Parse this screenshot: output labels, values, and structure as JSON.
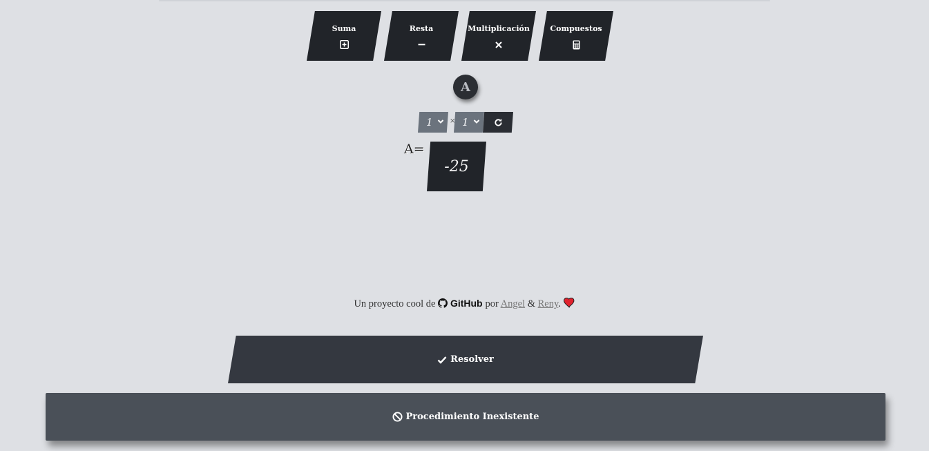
{
  "tabs": [
    {
      "label": "Suma",
      "icon": "plus-square-icon"
    },
    {
      "label": "Resta",
      "icon": "minus-icon"
    },
    {
      "label": "Multiplicación",
      "icon": "times-icon"
    },
    {
      "label": "Compuestos",
      "icon": "calculator-icon"
    }
  ],
  "matrix": {
    "badge_letter": "A",
    "rows": "1",
    "cols": "1",
    "times_symbol": "×",
    "label": "A=",
    "values": [
      "-25"
    ]
  },
  "credits": {
    "prefix": "Un proyecto cool de",
    "github": "GitHub",
    "por": "por",
    "author1": "Angel",
    "amp": "&",
    "author2": "Reny",
    "period": "."
  },
  "actions": {
    "solve_label": "Resolver",
    "procedure_label": "Procedimiento Inexistente"
  },
  "colors": {
    "background": "#dee0e4",
    "tab": "#212429",
    "solve_button": "#343840",
    "procedure_button": "#4a5058",
    "heart": "#e0222e"
  }
}
